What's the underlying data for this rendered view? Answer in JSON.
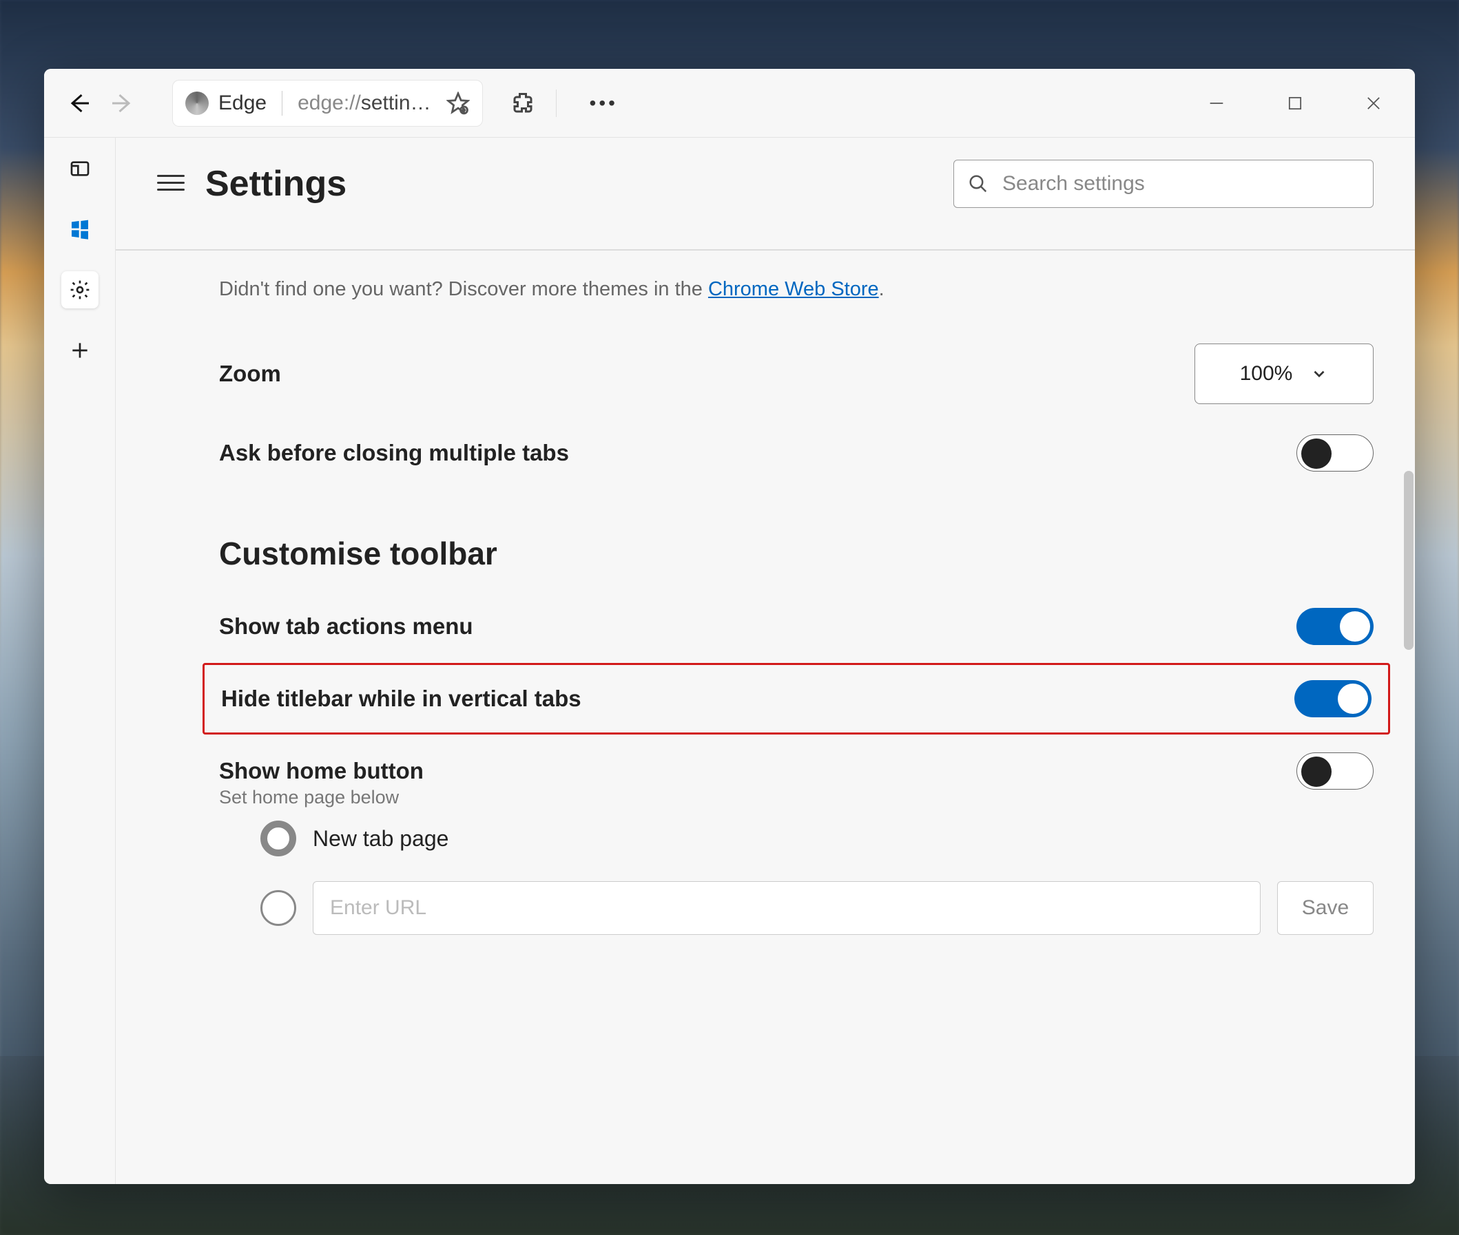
{
  "window": {
    "tab_label": "Edge",
    "tab_url_prefix": "edge://",
    "tab_url_rest": "settin…"
  },
  "header": {
    "title": "Settings",
    "search_placeholder": "Search settings"
  },
  "themes_hint": {
    "text": "Didn't find one you want? Discover more themes in the ",
    "link": "Chrome Web Store",
    "suffix": "."
  },
  "zoom": {
    "label": "Zoom",
    "value": "100%"
  },
  "ask_close": {
    "label": "Ask before closing multiple tabs",
    "on": false
  },
  "customise_title": "Customise toolbar",
  "tab_actions": {
    "label": "Show tab actions menu",
    "on": true
  },
  "hide_titlebar": {
    "label": "Hide titlebar while in vertical tabs",
    "on": true
  },
  "home_button": {
    "label": "Show home button",
    "sub": "Set home page below",
    "on": false
  },
  "home_radio": {
    "new_tab": "New tab page"
  },
  "home_url": {
    "placeholder": "Enter URL",
    "save": "Save"
  }
}
